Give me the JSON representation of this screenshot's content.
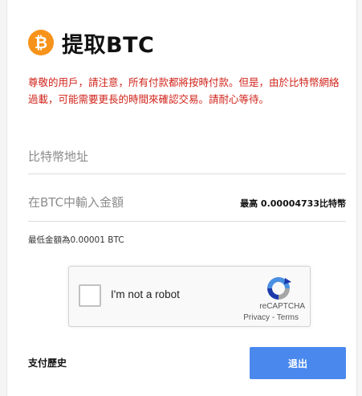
{
  "header": {
    "icon": "bitcoin-icon",
    "icon_glyph": "₿",
    "title": "提取BTC",
    "brand_color": "#f7931a"
  },
  "notice": {
    "text": "尊敬的用戶，請注意，所有付款都將按時付款。但是，由於比特幣網絡過載，可能需要更長的時間來確認交易。請耐心等待。",
    "color": "#d0231a"
  },
  "form": {
    "address_placeholder": "比特幣地址",
    "amount_placeholder": "在BTC中輸入金額",
    "max_label": "最高 0.00004733比特幣",
    "min_label": "最低金額為0.00001 BTC"
  },
  "captcha": {
    "checkbox_label": "I'm not a robot",
    "brand": "reCAPTCHA",
    "privacy": "Privacy",
    "separator": " - ",
    "terms": "Terms",
    "icon": "recaptcha-icon"
  },
  "footer": {
    "history_link": "支付歷史",
    "exit_button": "退出",
    "exit_color": "#4a88ee"
  }
}
